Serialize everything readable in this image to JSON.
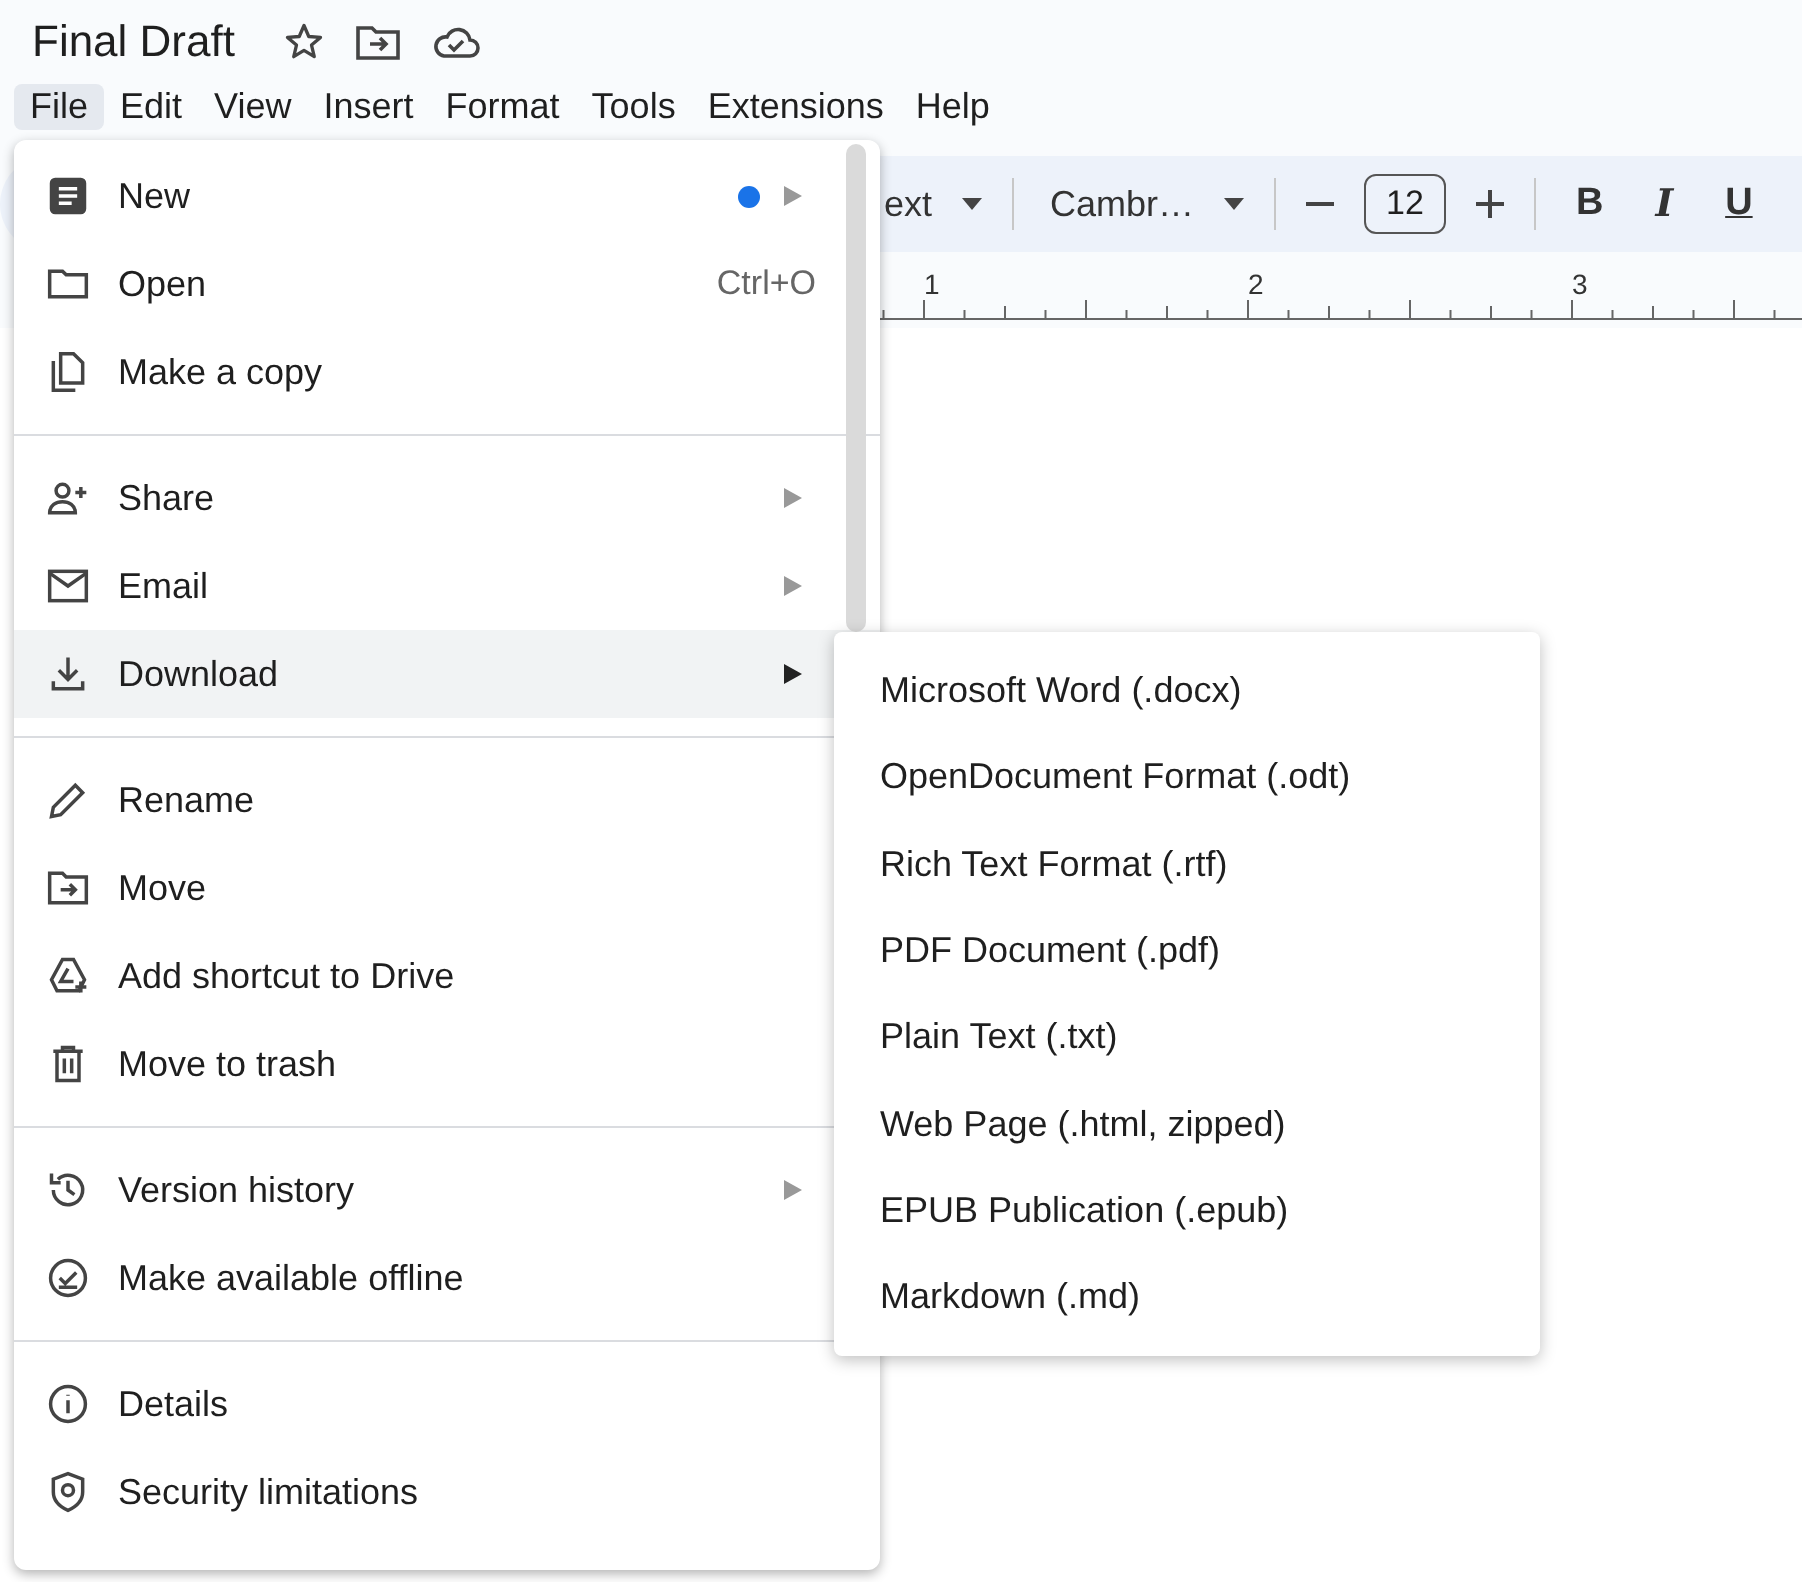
{
  "document": {
    "title": "Final Draft"
  },
  "menubar": [
    {
      "label": "File",
      "selected": true
    },
    {
      "label": "Edit",
      "selected": false
    },
    {
      "label": "View",
      "selected": false
    },
    {
      "label": "Insert",
      "selected": false
    },
    {
      "label": "Format",
      "selected": false
    },
    {
      "label": "Tools",
      "selected": false
    },
    {
      "label": "Extensions",
      "selected": false
    },
    {
      "label": "Help",
      "selected": false
    }
  ],
  "toolbar": {
    "style_text": "ext",
    "font": "Cambr…",
    "font_size": "12",
    "bold": "B",
    "italic": "I",
    "underline": "U"
  },
  "ruler": [
    "1",
    "2",
    "3"
  ],
  "file_menu": [
    [
      {
        "label": "New",
        "dot": true,
        "submenu": true,
        "selected": false
      },
      {
        "label": "Open",
        "shortcut": "Ctrl+O",
        "selected": false
      },
      {
        "label": "Make a copy",
        "selected": false
      }
    ],
    [
      {
        "label": "Share",
        "submenu": true,
        "selected": false
      },
      {
        "label": "Email",
        "submenu": true,
        "selected": false
      },
      {
        "label": "Download",
        "submenu": true,
        "selected": true
      }
    ],
    [
      {
        "label": "Rename",
        "selected": false
      },
      {
        "label": "Move",
        "selected": false
      },
      {
        "label": "Add shortcut to Drive",
        "selected": false
      },
      {
        "label": "Move to trash",
        "selected": false
      }
    ],
    [
      {
        "label": "Version history",
        "submenu": true,
        "selected": false
      },
      {
        "label": "Make available offline",
        "selected": false
      }
    ],
    [
      {
        "label": "Details",
        "selected": false
      },
      {
        "label": "Security limitations",
        "selected": false
      }
    ]
  ],
  "download_submenu": [
    "Microsoft Word (.docx)",
    "OpenDocument Format (.odt)",
    "Rich Text Format (.rtf)",
    "PDF Document (.pdf)",
    "Plain Text (.txt)",
    "Web Page (.html, zipped)",
    "EPUB Publication (.epub)",
    "Markdown (.md)"
  ]
}
